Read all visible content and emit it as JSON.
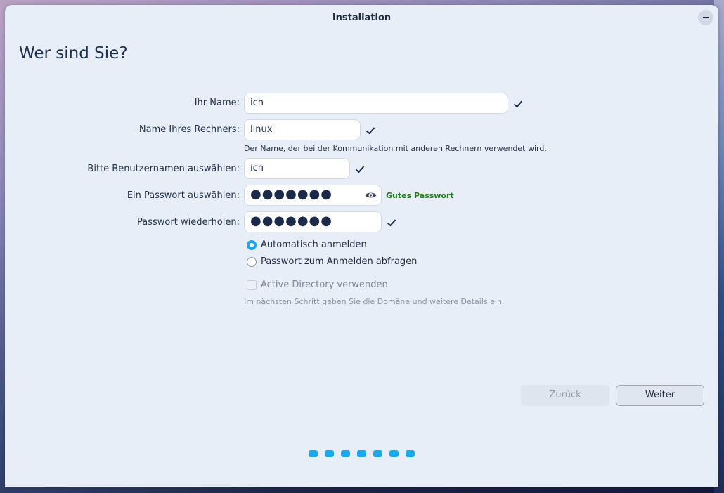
{
  "window": {
    "title": "Installation"
  },
  "page": {
    "heading": "Wer sind Sie?"
  },
  "form": {
    "name_label": "Ihr Name:",
    "name_value": "ich",
    "computer_label": "Name Ihres Rechners:",
    "computer_value": "linux",
    "computer_hint": "Der Name, der bei der Kommunikation mit anderen Rechnern verwendet wird.",
    "username_label": "Bitte Benutzernamen auswählen:",
    "username_value": "ich",
    "password_label": "Ein Passwort auswählen:",
    "password_value": "●●●●●●●",
    "password_strength": "Gutes Passwort",
    "password_repeat_label": "Passwort wiederholen:",
    "password_repeat_value": "●●●●●●●"
  },
  "login_options": {
    "auto_login": "Automatisch anmelden",
    "ask_password": "Passwort zum Anmelden abfragen",
    "selected": "auto_login"
  },
  "active_directory": {
    "label": "Active Directory verwenden",
    "hint": "Im nächsten Schritt geben Sie die Domäne und weitere Details ein.",
    "checked": false,
    "enabled": false
  },
  "buttons": {
    "back": "Zurück",
    "next": "Weiter"
  },
  "progress": {
    "steps": 7
  },
  "colors": {
    "accent": "#19a9ec",
    "strength_good": "#1f7a1f",
    "window_bg": "#e8eef7"
  }
}
